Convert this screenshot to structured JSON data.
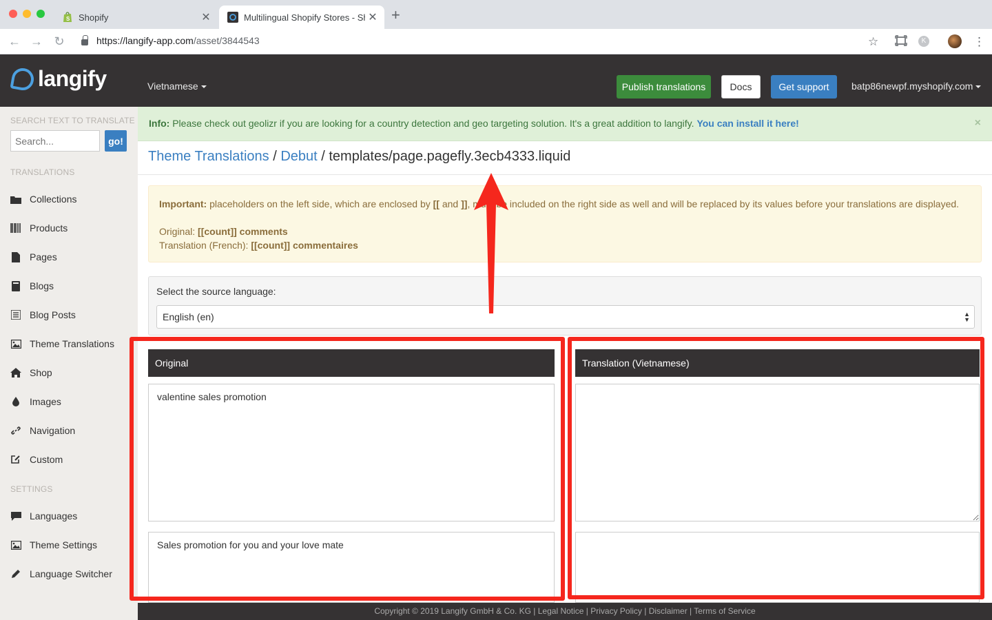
{
  "browser": {
    "tabs": [
      {
        "title": "Shopify",
        "icon": "shopify-icon"
      },
      {
        "title": "Multilingual Shopify Stores - Sh",
        "icon": "langify-icon"
      }
    ],
    "new_tab": "+",
    "url_host": "https://langify-app.com",
    "url_path": "/asset/3844543",
    "k_avatar": "K"
  },
  "header": {
    "logo_text": "langify",
    "language": "Vietnamese",
    "publish_label": "Publish translations",
    "docs_label": "Docs",
    "support_label": "Get support",
    "shop_domain": "batp86newpf.myshopify.com"
  },
  "sidebar": {
    "search_heading": "SEARCH TEXT TO TRANSLATE",
    "search_placeholder": "Search...",
    "go_label": "go!",
    "translations_heading": "TRANSLATIONS",
    "translations": [
      {
        "label": "Collections",
        "icon": "folder-icon"
      },
      {
        "label": "Products",
        "icon": "barcode-icon"
      },
      {
        "label": "Pages",
        "icon": "file-icon"
      },
      {
        "label": "Blogs",
        "icon": "book-icon"
      },
      {
        "label": "Blog Posts",
        "icon": "list-icon"
      },
      {
        "label": "Theme Translations",
        "icon": "picture-icon"
      },
      {
        "label": "Shop",
        "icon": "home-icon"
      },
      {
        "label": "Images",
        "icon": "tint-icon"
      },
      {
        "label": "Navigation",
        "icon": "link-icon"
      },
      {
        "label": "Custom",
        "icon": "edit-icon"
      }
    ],
    "settings_heading": "SETTINGS",
    "settings": [
      {
        "label": "Languages",
        "icon": "comment-icon"
      },
      {
        "label": "Theme Settings",
        "icon": "picture-icon"
      },
      {
        "label": "Language Switcher",
        "icon": "pencil-icon"
      }
    ]
  },
  "info": {
    "prefix": "Info:",
    "message": " Please check out geolizr if you are looking for a country detection and geo targeting solution. It's a great addition to langify. ",
    "link": "You can install it here!",
    "close": "×"
  },
  "breadcrumb": {
    "part1": "Theme Translations",
    "sep": " / ",
    "part2": "Debut",
    "current": "templates/page.pagefly.3ecb4333.liquid"
  },
  "important": {
    "label": "Important:",
    "text_a": " placeholders on the left side, which are enclosed by ",
    "open_br": "[[",
    "and": " and ",
    "close_br": "]]",
    "text_b": ", must be included on the right side as well and will be replaced by its values before your translations are displayed.",
    "orig_label": "Original: ",
    "orig_value": "[[count]] comments",
    "trans_label": "Translation (French): ",
    "trans_value": "[[count]] commentaires"
  },
  "source": {
    "label": "Select the source language:",
    "selected": "English (en)"
  },
  "columns": {
    "original_heading": "Original",
    "translation_heading": "Translation (Vietnamese)",
    "original_1": "valentine sales promotion",
    "original_2": "Sales promotion for you and your love mate",
    "translation_1": "",
    "translation_2": ""
  },
  "footer": {
    "copyright": "Copyright © 2019 Langify GmbH & Co. KG | Legal Notice | Privacy Policy | Disclaimer | Terms of Service"
  },
  "colors": {
    "header_bg": "#353233",
    "accent_blue": "#3a7fc1",
    "publish_green": "#3c8c3c",
    "annotation_red": "#f5271d"
  }
}
